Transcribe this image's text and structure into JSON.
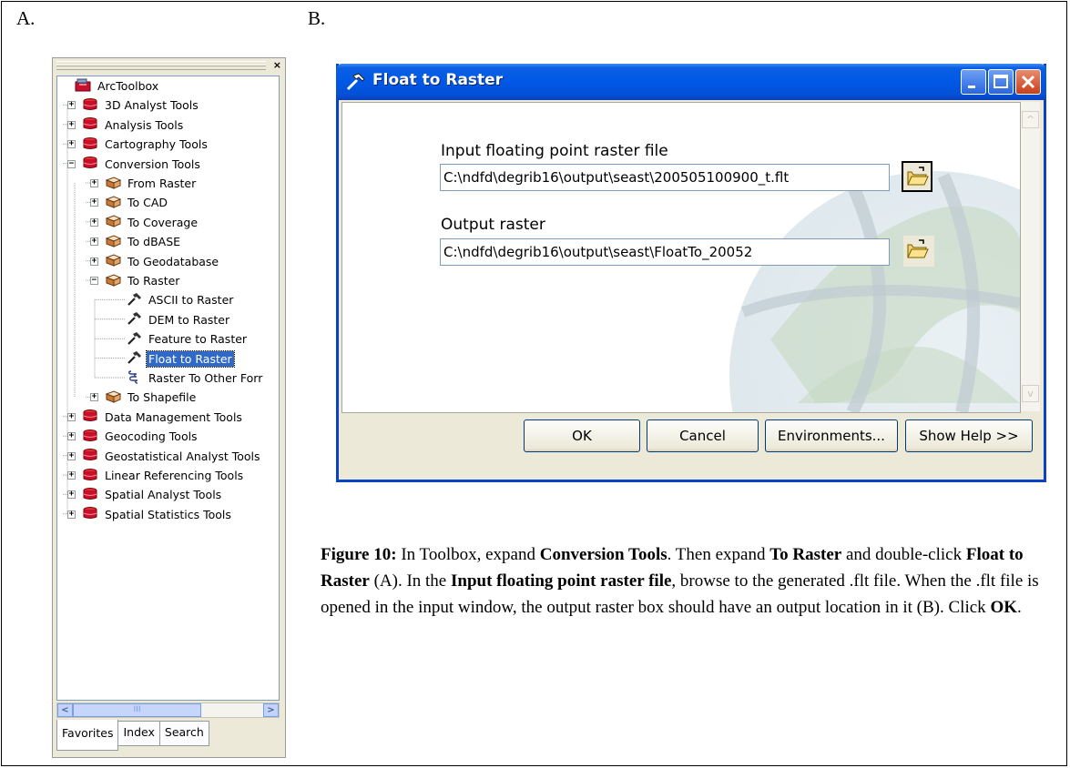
{
  "panel_labels": {
    "a": "A.",
    "b": "B."
  },
  "toolbox": {
    "close_glyph": "×",
    "tree": [
      {
        "label": "ArcToolbox",
        "icon": "arctoolbox-icon"
      },
      {
        "label": "3D Analyst Tools",
        "icon": "toolbox-icon"
      },
      {
        "label": "Analysis Tools",
        "icon": "toolbox-icon"
      },
      {
        "label": "Cartography Tools",
        "icon": "toolbox-icon"
      },
      {
        "label": "Conversion Tools",
        "icon": "toolbox-icon"
      },
      {
        "label": "From Raster",
        "icon": "toolset-icon"
      },
      {
        "label": "To CAD",
        "icon": "toolset-icon"
      },
      {
        "label": "To Coverage",
        "icon": "toolset-icon"
      },
      {
        "label": "To dBASE",
        "icon": "toolset-icon"
      },
      {
        "label": "To Geodatabase",
        "icon": "toolset-icon"
      },
      {
        "label": "To Raster",
        "icon": "toolset-icon"
      },
      {
        "label": "ASCII to Raster",
        "icon": "hammer-icon"
      },
      {
        "label": "DEM to Raster",
        "icon": "hammer-icon"
      },
      {
        "label": "Feature to Raster",
        "icon": "hammer-icon"
      },
      {
        "label": "Float to Raster",
        "icon": "hammer-icon"
      },
      {
        "label": "Raster To Other Forr",
        "icon": "script-icon"
      },
      {
        "label": "To Shapefile",
        "icon": "toolset-icon"
      },
      {
        "label": "Data Management Tools",
        "icon": "toolbox-icon"
      },
      {
        "label": "Geocoding Tools",
        "icon": "toolbox-icon"
      },
      {
        "label": "Geostatistical Analyst Tools",
        "icon": "toolbox-icon"
      },
      {
        "label": "Linear Referencing Tools",
        "icon": "toolbox-icon"
      },
      {
        "label": "Spatial Analyst Tools",
        "icon": "toolbox-icon"
      },
      {
        "label": "Spatial Statistics Tools",
        "icon": "toolbox-icon"
      }
    ],
    "selected_item": "Float to Raster",
    "scroll_left": "<",
    "scroll_right": ">",
    "scroll_thumb_grip": "III",
    "tabs": [
      "Favorites",
      "Index",
      "Search"
    ],
    "active_tab": "Favorites"
  },
  "dialog": {
    "title": "Float to Raster",
    "input_label": "Input floating point raster file",
    "input_value": "C:\\ndfd\\degrib16\\output\\seast\\200505100900_t.flt",
    "output_label": "Output raster",
    "output_value": "C:\\ndfd\\degrib16\\output\\seast\\FloatTo_20052",
    "scroll_up": "^",
    "scroll_down": "v",
    "buttons": {
      "ok": "OK",
      "cancel": "Cancel",
      "environments": "Environments...",
      "show_help": "Show Help >>"
    }
  },
  "caption": {
    "figure_label": "Figure 10:",
    "t1": " In Toolbox, expand ",
    "b1": "Conversion Tools",
    "t2": ".  Then expand ",
    "b2": "To Raster",
    "t3": " and double-click ",
    "b3": "Float to Raster",
    "t4": " (A).  In the ",
    "b4": "Input floating point raster file",
    "t5": ", browse to the generated .flt file.  When the .flt file is opened in the input window, the output raster box should have an output location in it (B).  Click ",
    "b5": "OK",
    "t6": "."
  },
  "colors": {
    "titlebar": "#0058e6",
    "selection": "#316ac5",
    "toolbox_red": "#c8102e"
  }
}
